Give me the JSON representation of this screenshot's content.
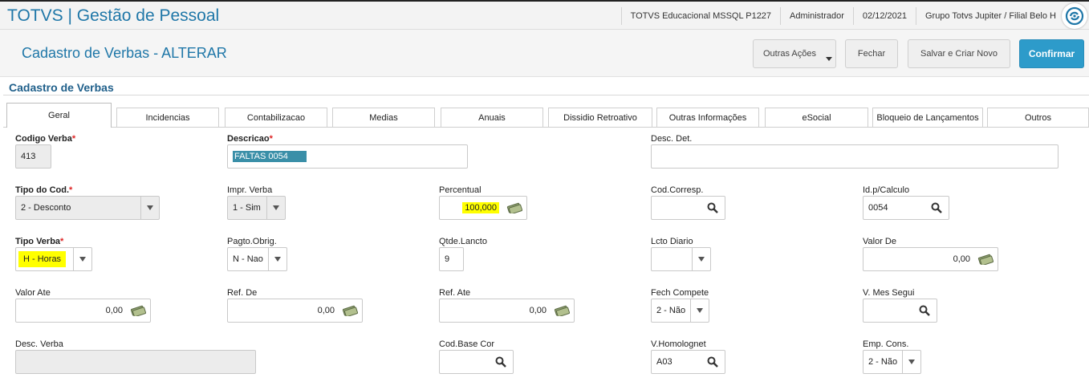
{
  "app": {
    "title": "TOTVS | Gestão de Pessoal",
    "database": "TOTVS Educacional MSSQL P1227",
    "user": "Administrador",
    "date": "02/12/2021",
    "company": "Grupo Totvs Jupiter / Filial Belo H"
  },
  "header": {
    "title": "Cadastro de Verbas - ALTERAR",
    "outras_acoes": "Outras Ações",
    "fechar": "Fechar",
    "salvar": "Salvar e Criar Novo",
    "confirmar": "Confirmar"
  },
  "section": {
    "title": "Cadastro de Verbas"
  },
  "tabs": [
    "Geral",
    "Incidencias",
    "Contabilizacao",
    "Medias",
    "Anuais",
    "Dissidio Retroativo",
    "Outras Informações",
    "eSocial",
    "Bloqueio de Lançamentos",
    "Outros"
  ],
  "fields": {
    "codigo_verba": {
      "label": "Codigo Verba",
      "value": "413"
    },
    "descricao": {
      "label": "Descricao",
      "value": "FALTAS 0054"
    },
    "desc_det": {
      "label": "Desc. Det.",
      "value": ""
    },
    "tipo_cod": {
      "label": "Tipo do Cod.",
      "value": "2 - Desconto"
    },
    "impr_verba": {
      "label": "Impr. Verba",
      "value": "1 - Sim"
    },
    "percentual": {
      "label": "Percentual",
      "value": "100,000"
    },
    "cod_corresp": {
      "label": "Cod.Corresp.",
      "value": ""
    },
    "id_calculo": {
      "label": "Id.p/Calculo",
      "value": "0054"
    },
    "tipo_verba": {
      "label": "Tipo Verba",
      "value": "H - Horas"
    },
    "pagto_obrig": {
      "label": "Pagto.Obrig.",
      "value": "N - Nao"
    },
    "qtde_lancto": {
      "label": "Qtde.Lancto",
      "value": "9"
    },
    "lcto_diario": {
      "label": "Lcto Diario",
      "value": ""
    },
    "valor_de": {
      "label": "Valor De",
      "value": "0,00"
    },
    "valor_ate": {
      "label": "Valor Ate",
      "value": "0,00"
    },
    "ref_de": {
      "label": "Ref. De",
      "value": "0,00"
    },
    "ref_ate": {
      "label": "Ref. Ate",
      "value": "0,00"
    },
    "fech_compete": {
      "label": "Fech Compete",
      "value": "2 - Não"
    },
    "v_mes_segui": {
      "label": "V. Mes Segui",
      "value": ""
    },
    "desc_verba": {
      "label": "Desc. Verba",
      "value": ""
    },
    "cod_base_cor": {
      "label": "Cod.Base Cor",
      "value": ""
    },
    "v_homolognet": {
      "label": "V.Homolognet",
      "value": "A03"
    },
    "emp_cons": {
      "label": "Emp. Cons.",
      "value": "2 - Não"
    }
  },
  "colors": {
    "brand": "#1f77a8",
    "confirm": "#2d9bca",
    "highlight": "#ffff00",
    "selection": "#3a8fa8"
  }
}
